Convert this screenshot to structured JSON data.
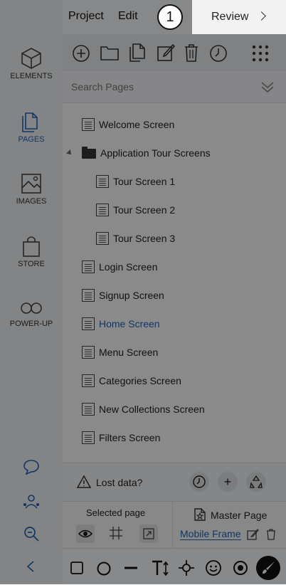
{
  "topbar": {
    "menu_project": "Project",
    "menu_edit": "Edit",
    "step_number": "1",
    "review_label": "Review"
  },
  "sidebar": {
    "items": [
      {
        "label": "ELEMENTS",
        "icon": "cube-icon"
      },
      {
        "label": "PAGES",
        "icon": "pages-icon",
        "active": true
      },
      {
        "label": "IMAGES",
        "icon": "image-icon"
      },
      {
        "label": "STORE",
        "icon": "bag-icon"
      },
      {
        "label": "POWER-UP",
        "icon": "infinity-icon"
      }
    ]
  },
  "search": {
    "placeholder": "Search Pages"
  },
  "pages": [
    {
      "label": "Welcome Screen"
    },
    {
      "label": "Application Tour Screens",
      "type": "folder"
    },
    {
      "label": "Tour Screen 1",
      "indent": true
    },
    {
      "label": "Tour Screen 2",
      "indent": true
    },
    {
      "label": "Tour Screen 3",
      "indent": true
    },
    {
      "label": "Login Screen"
    },
    {
      "label": "Signup Screen"
    },
    {
      "label": "Home Screen",
      "active": true
    },
    {
      "label": "Menu Screen"
    },
    {
      "label": "Categories Screen"
    },
    {
      "label": "New Collections Screen"
    },
    {
      "label": "Filters Screen"
    }
  ],
  "lost_data": {
    "label": "Lost data?"
  },
  "selected_page": {
    "label": "Selected page"
  },
  "master_page": {
    "label": "Master Page",
    "link": "Mobile Frame"
  },
  "colors": {
    "accent": "#1e63b8",
    "overlay": "rgba(0,0,0,0.45)"
  }
}
